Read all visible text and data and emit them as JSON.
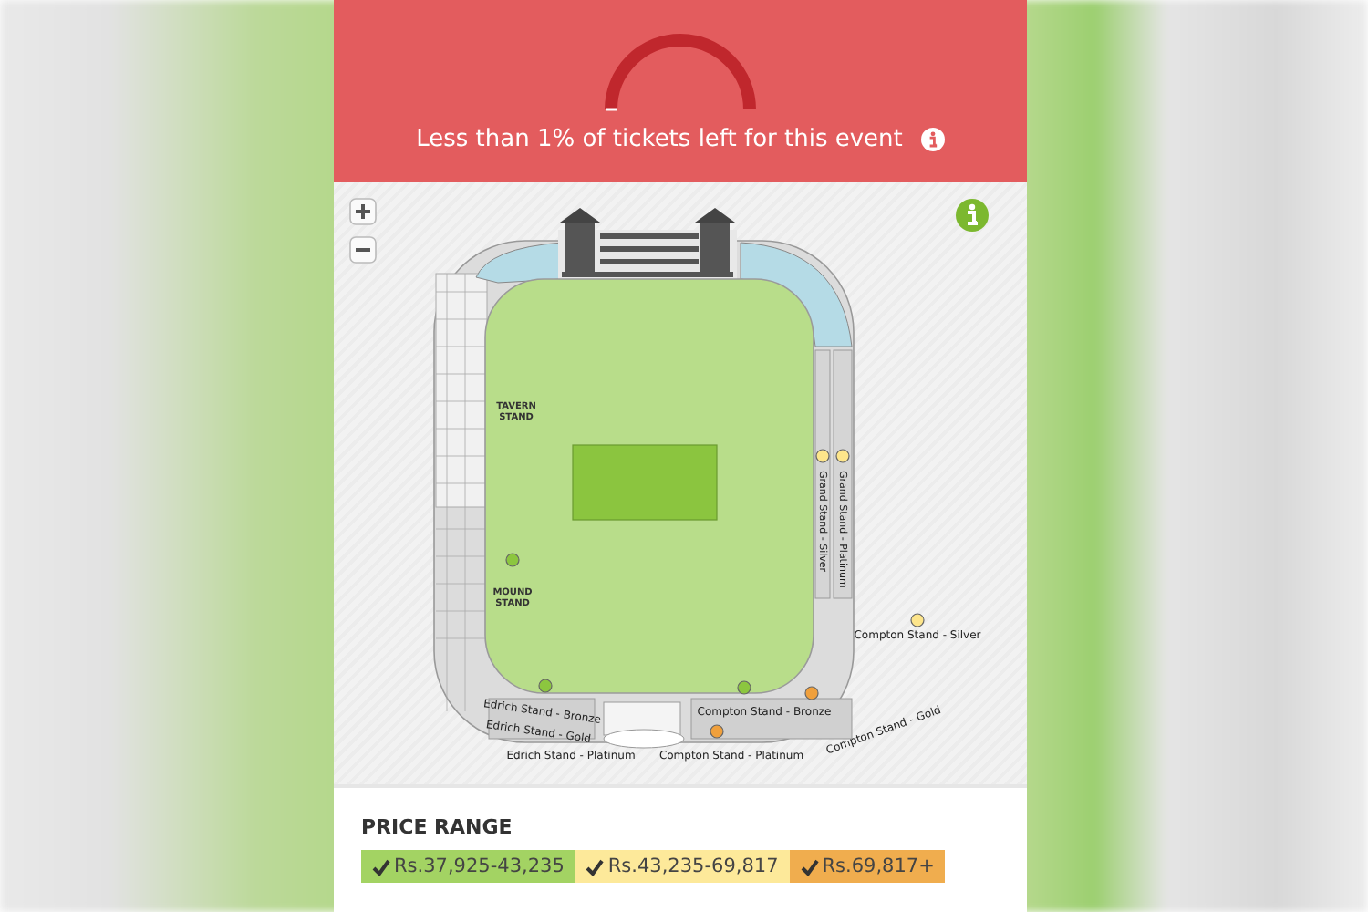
{
  "availability": {
    "message": "Less than 1% of tickets left for this event"
  },
  "map": {
    "labels": [
      {
        "text": "TAVERN STAND",
        "kind": "stand"
      },
      {
        "text": "MOUND STAND",
        "kind": "stand"
      },
      {
        "text": "Grand Stand - Silver",
        "kind": "vertical"
      },
      {
        "text": "Grand Stand - Platinum",
        "kind": "vertical"
      },
      {
        "text": "Compton Stand - Silver",
        "kind": "small"
      },
      {
        "text": "Edrich Stand - Bronze",
        "kind": "small"
      },
      {
        "text": "Edrich Stand - Gold",
        "kind": "small"
      },
      {
        "text": "Edrich Stand - Platinum",
        "kind": "small"
      },
      {
        "text": "Compton Stand - Bronze",
        "kind": "small"
      },
      {
        "text": "Compton Stand - Gold",
        "kind": "small"
      },
      {
        "text": "Compton Stand - Platinum",
        "kind": "small"
      }
    ],
    "markers": [
      {
        "color": "#8cc63f"
      },
      {
        "color": "#8cc63f"
      },
      {
        "color": "#8cc63f"
      },
      {
        "color": "#fde58b"
      },
      {
        "color": "#fde58b"
      },
      {
        "color": "#fde58b"
      },
      {
        "color": "#f0a03c"
      },
      {
        "color": "#f0a03c"
      }
    ]
  },
  "price_range": {
    "title": "PRICE RANGE",
    "tiers": [
      {
        "label": "Rs.37,925-43,235",
        "checked": true,
        "color": "#a3d363"
      },
      {
        "label": "Rs.43,235-69,817",
        "checked": true,
        "color": "#fde99a"
      },
      {
        "label": "Rs.69,817+",
        "checked": true,
        "color": "#f0ad4e"
      }
    ]
  }
}
